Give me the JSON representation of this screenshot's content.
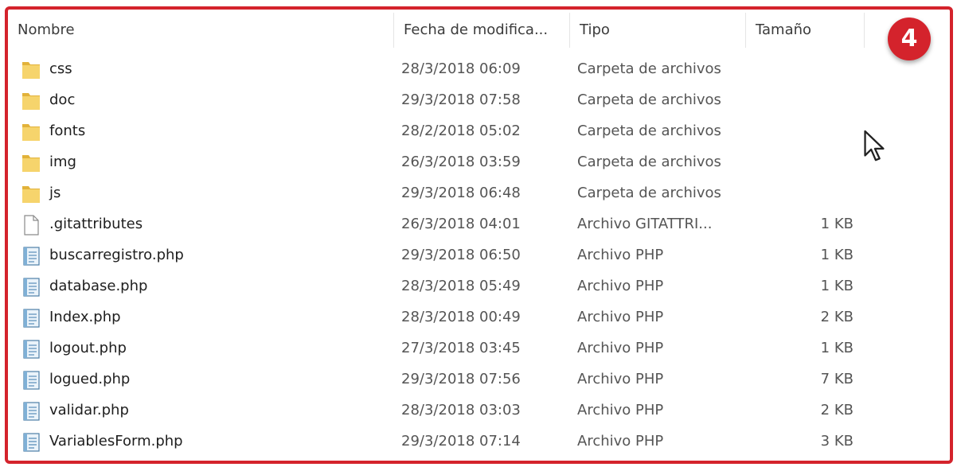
{
  "columns": {
    "name": "Nombre",
    "date": "Fecha de modifica...",
    "type": "Tipo",
    "size": "Tamaño"
  },
  "step_badge": "4",
  "files": [
    {
      "name": "css",
      "date": "28/3/2018 06:09",
      "type": "Carpeta de archivos",
      "size": "",
      "icon": "folder-icon"
    },
    {
      "name": "doc",
      "date": "29/3/2018 07:58",
      "type": "Carpeta de archivos",
      "size": "",
      "icon": "folder-icon"
    },
    {
      "name": "fonts",
      "date": "28/2/2018 05:02",
      "type": "Carpeta de archivos",
      "size": "",
      "icon": "folder-icon"
    },
    {
      "name": "img",
      "date": "26/3/2018 03:59",
      "type": "Carpeta de archivos",
      "size": "",
      "icon": "folder-icon"
    },
    {
      "name": "js",
      "date": "29/3/2018 06:48",
      "type": "Carpeta de archivos",
      "size": "",
      "icon": "folder-icon"
    },
    {
      "name": ".gitattributes",
      "date": "26/3/2018 04:01",
      "type": "Archivo GITATTRI...",
      "size": "1 KB",
      "icon": "file-icon"
    },
    {
      "name": "buscarregistro.php",
      "date": "29/3/2018 06:50",
      "type": "Archivo PHP",
      "size": "1 KB",
      "icon": "php-file-icon"
    },
    {
      "name": "database.php",
      "date": "28/3/2018 05:49",
      "type": "Archivo PHP",
      "size": "1 KB",
      "icon": "php-file-icon"
    },
    {
      "name": "Index.php",
      "date": "28/3/2018 00:49",
      "type": "Archivo PHP",
      "size": "2 KB",
      "icon": "php-file-icon"
    },
    {
      "name": "logout.php",
      "date": "27/3/2018 03:45",
      "type": "Archivo PHP",
      "size": "1 KB",
      "icon": "php-file-icon"
    },
    {
      "name": "logued.php",
      "date": "29/3/2018 07:56",
      "type": "Archivo PHP",
      "size": "7 KB",
      "icon": "php-file-icon"
    },
    {
      "name": "validar.php",
      "date": "28/3/2018 03:03",
      "type": "Archivo PHP",
      "size": "2 KB",
      "icon": "php-file-icon"
    },
    {
      "name": "VariablesForm.php",
      "date": "29/3/2018 07:14",
      "type": "Archivo PHP",
      "size": "3 KB",
      "icon": "php-file-icon"
    }
  ],
  "colors": {
    "highlight_border": "#d4232c",
    "folder": "#f6d46c"
  }
}
